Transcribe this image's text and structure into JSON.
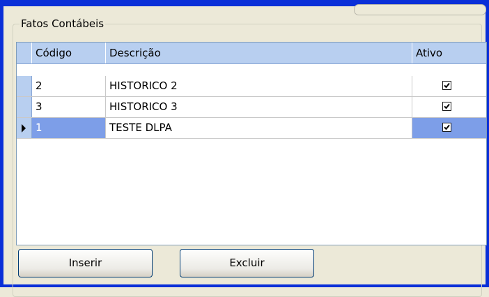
{
  "group_title": "Fatos Contábeis",
  "grid": {
    "columns": [
      "Código",
      "Descrição",
      "Ativo"
    ],
    "rows": [
      {
        "codigo": "2",
        "descricao": "HISTORICO 2",
        "ativo": true,
        "selected": false
      },
      {
        "codigo": "3",
        "descricao": "HISTORICO 3",
        "ativo": true,
        "selected": false
      },
      {
        "codigo": "1",
        "descricao": "TESTE DLPA",
        "ativo": true,
        "selected": true
      }
    ]
  },
  "buttons": {
    "insert_label": "Inserir",
    "delete_label": "Excluir"
  },
  "colors": {
    "title_bar": "#0a2fd8",
    "header_bg": "#b8cff0",
    "selection_bg": "#7d9ee8",
    "window_bg": "#ece9d8"
  }
}
